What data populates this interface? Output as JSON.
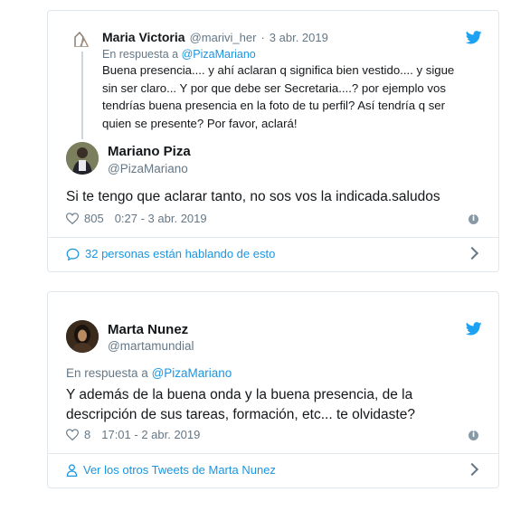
{
  "tweet1": {
    "quoted": {
      "name": "Maria Victoria",
      "handle": "@marivi_her",
      "separator": "·",
      "date": "3 abr. 2019",
      "reply_prefix": "En respuesta a",
      "reply_to": "@PizaMariano",
      "text_lines": [
        "Buena presencia.... y ahí aclaran q significa bien vestido.... y sigue",
        "sin ser claro... Y por que debe ser Secretaria....? por ejemplo vos",
        "tendrías buena presencia en la foto de tu perfil? Así tendría q ser",
        "quien se presente? Por favor, aclará!"
      ]
    },
    "author": {
      "name": "Mariano Piza",
      "handle": "@PizaMariano"
    },
    "text": "Si te tengo que aclarar tanto, no sos vos la indicada.saludos",
    "likes": "805",
    "time": "0:27 - 3 abr. 2019",
    "footer_link": "32 personas están hablando de esto"
  },
  "tweet2": {
    "author": {
      "name": "Marta Nunez",
      "handle": "@martamundial"
    },
    "reply_prefix": "En respuesta a",
    "reply_to": "@PizaMariano",
    "text_lines": [
      "Y además de la buena onda y la buena presencia, de la",
      "descripción de sus tareas, formación, etc... te olvidaste?"
    ],
    "likes": "8",
    "time": "17:01 - 2 abr. 2019",
    "footer_link": "Ver los otros Tweets de Marta Nunez"
  },
  "colors": {
    "brand_blue": "#1da1f2",
    "link_blue": "#1b95e0",
    "secondary_text": "#657786",
    "border": "#e1e8ed"
  },
  "icons": {
    "brand": "twitter-bird-icon",
    "like": "heart-icon",
    "info": "info-icon",
    "conversation": "speech-bubble-icon",
    "profile": "person-icon",
    "chevron": "chevron-right-icon"
  }
}
